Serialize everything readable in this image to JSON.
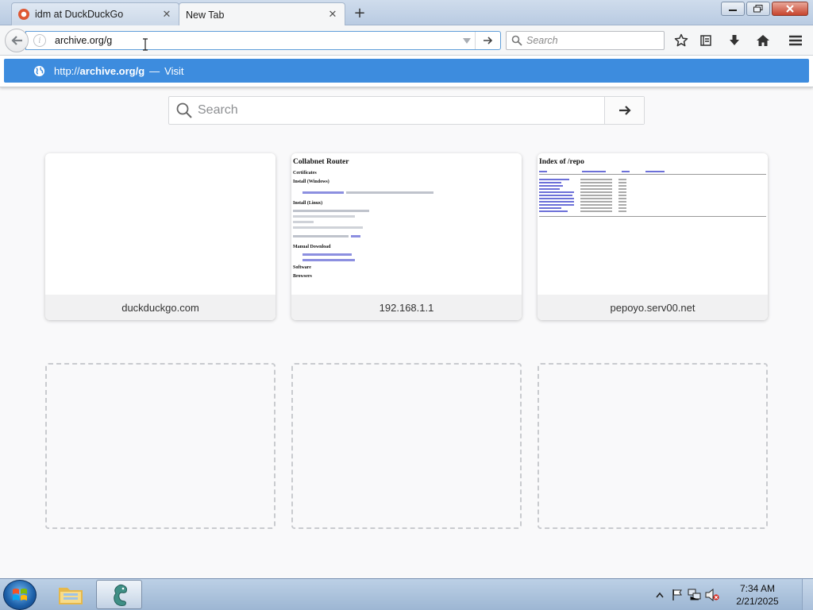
{
  "browser": {
    "tabs": [
      {
        "label": "idm at DuckDuckGo",
        "active": false
      },
      {
        "label": "New Tab",
        "active": true
      }
    ],
    "url": "archive.org/g",
    "search_placeholder": "Search"
  },
  "autocomplete": {
    "prefix": "http://",
    "bold_part": "archive.org/g",
    "separator": "—",
    "action": "Visit"
  },
  "newtab": {
    "search_placeholder": "Search",
    "tiles": [
      {
        "title": "duckduckgo.com"
      },
      {
        "title": "192.168.1.1",
        "preview": {
          "heading": "Collabnet Router",
          "sections": [
            "Certificates",
            "Install (Windows)",
            "Install (Linux)",
            "Manual Download",
            "Software",
            "Browsers"
          ]
        }
      },
      {
        "title": "pepoyo.serv00.net",
        "preview": {
          "heading": "Index of /repo"
        }
      }
    ]
  },
  "taskbar": {
    "clock_time": "7:34 AM",
    "clock_date": "2/21/2025"
  },
  "colors": {
    "accent": "#3d8cde",
    "tab_strip": "#c3d4e8",
    "page_background": "#f9f9fa",
    "duckduckgo": "#de5833"
  }
}
